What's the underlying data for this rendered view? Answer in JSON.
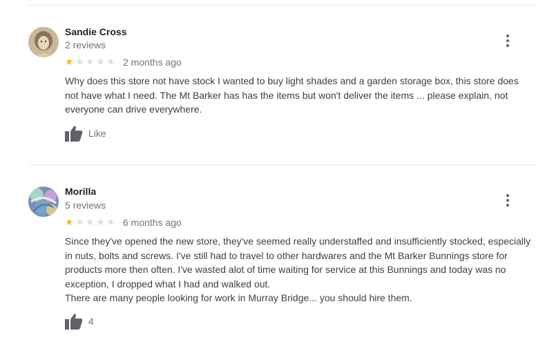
{
  "reviews": [
    {
      "author": "Sandie Cross",
      "review_count": "2 reviews",
      "rating": 1,
      "max_rating": 5,
      "date": "2 months ago",
      "text": "Why does this store not have stock I wanted to buy light shades and a garden storage box, this store does not have what I need. The Mt Barker has has the items but won't deliver the items ... please explain, not everyone can drive everywhere.",
      "like_label": "Like",
      "avatar_icon": "vintage-portrait-avatar"
    },
    {
      "author": "Morilla",
      "review_count": "5 reviews",
      "rating": 1,
      "max_rating": 5,
      "date": "6 months ago",
      "text": "Since they've opened the new store, they've seemed really understaffed and insufficiently stocked, especially in nuts, bolts and screws. I've still had to travel to other hardwares and the Mt Barker Bunnings store for products more then often. I've wasted alot of time waiting for service at this Bunnings and today was no exception, I dropped what I had and walked out.\nThere are many people looking for work in Murray Bridge... you should hire them.",
      "like_label": "4",
      "avatar_icon": "colorful-abstract-avatar"
    }
  ],
  "colors": {
    "star_on": "#fbbc04",
    "star_off": "#dadce0",
    "secondary_text": "#70757a",
    "icon": "#5f6368"
  }
}
